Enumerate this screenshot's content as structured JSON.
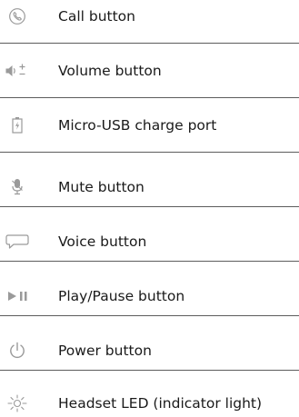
{
  "legend": {
    "items": [
      {
        "icon": "phone-icon",
        "label": "Call button"
      },
      {
        "icon": "volume-icon",
        "label": "Volume button"
      },
      {
        "icon": "battery-charge-icon",
        "label": "Micro-USB charge port"
      },
      {
        "icon": "microphone-mute-icon",
        "label": "Mute button"
      },
      {
        "icon": "speech-bubble-icon",
        "label": "Voice button"
      },
      {
        "icon": "play-pause-icon",
        "label": "Play/Pause button"
      },
      {
        "icon": "power-icon",
        "label": "Power button"
      },
      {
        "icon": "led-light-icon",
        "label": "Headset LED (indicator light)"
      }
    ]
  },
  "colors": {
    "icon": "#9a9a9a",
    "divider": "#5c5c5c",
    "text": "#1a1a1a"
  }
}
